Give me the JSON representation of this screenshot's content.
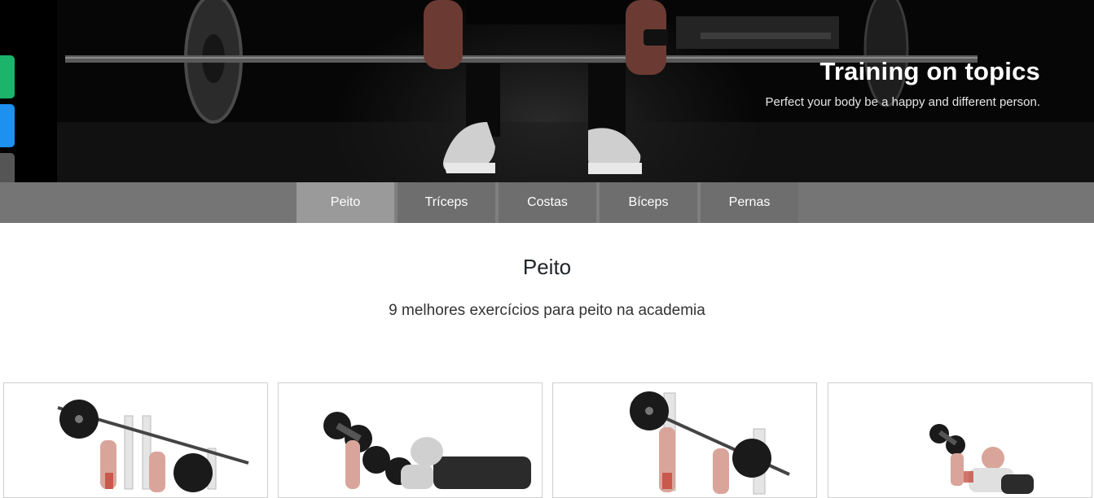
{
  "hero": {
    "title": "Training on topics",
    "subtitle": "Perfect your body be a happy and different person."
  },
  "side_buttons": [
    {
      "icon": "green-share-icon",
      "color": "#1cb36b"
    },
    {
      "icon": "blue-share-icon",
      "color": "#1e90f0"
    },
    {
      "icon": "gray-share-icon",
      "color": "#555555"
    }
  ],
  "tabs": [
    {
      "label": "Peito",
      "active": true
    },
    {
      "label": "Tríceps",
      "active": false
    },
    {
      "label": "Costas",
      "active": false
    },
    {
      "label": "Bíceps",
      "active": false
    },
    {
      "label": "Pernas",
      "active": false
    }
  ],
  "section": {
    "title": "Peito",
    "subtitle": "9 melhores exercícios para peito na academia"
  },
  "cards": [
    {
      "image": "incline-barbell-bench-press-illustration"
    },
    {
      "image": "dumbbell-bench-press-illustration"
    },
    {
      "image": "decline-barbell-press-illustration"
    },
    {
      "image": "dumbbell-fly-illustration"
    }
  ]
}
